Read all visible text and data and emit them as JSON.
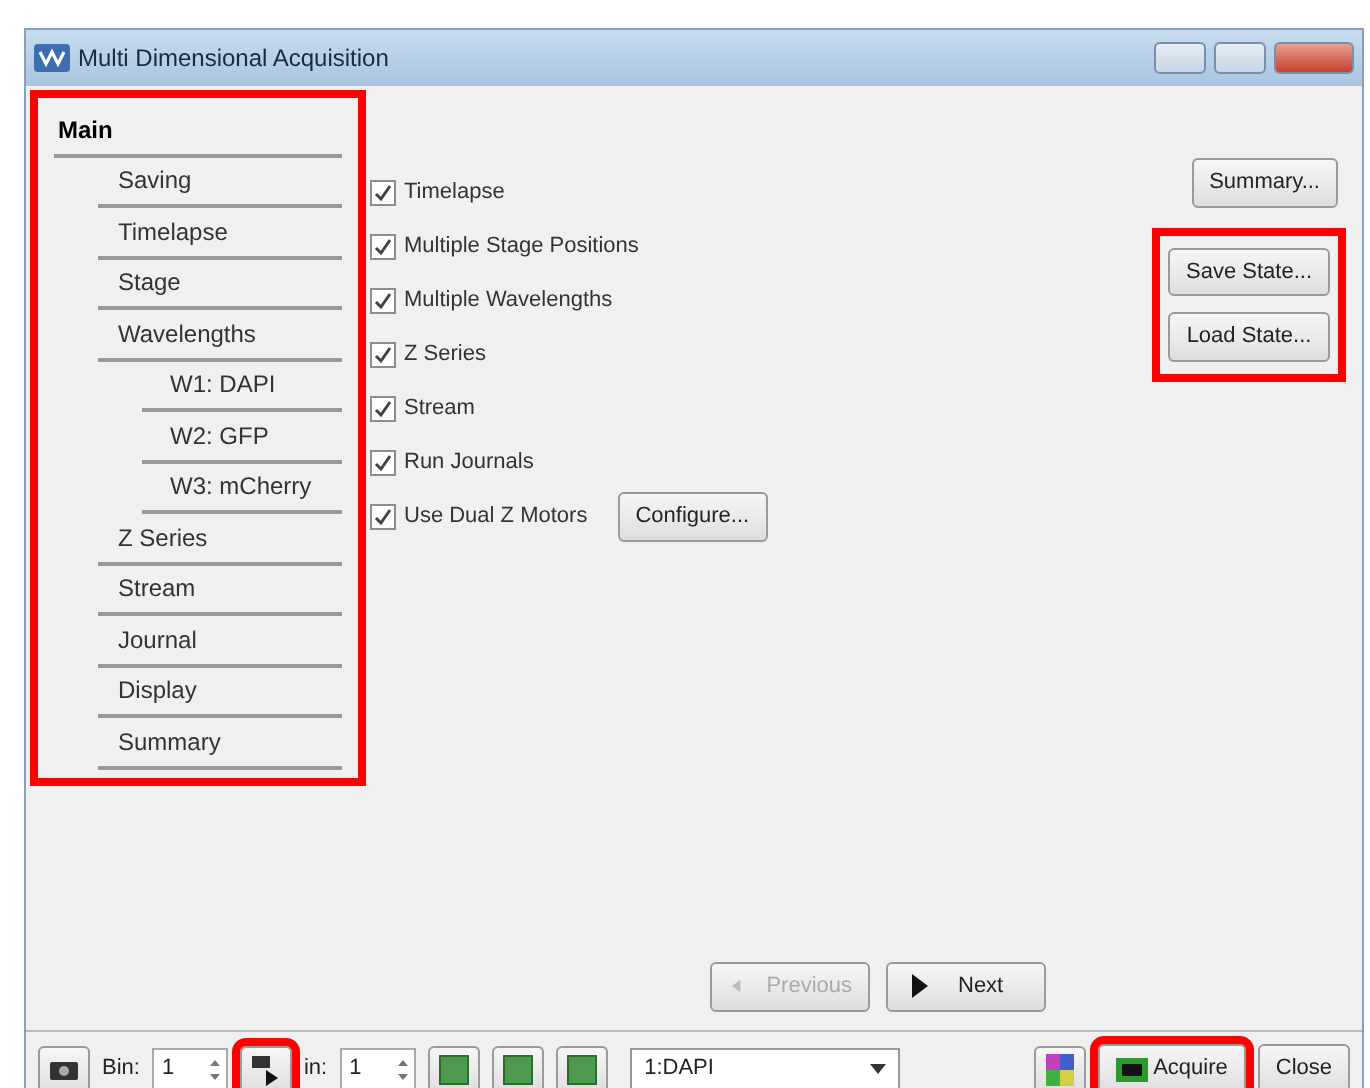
{
  "window": {
    "title": "Multi Dimensional Acquisition"
  },
  "sidebar": {
    "highlighted": true,
    "items": [
      {
        "label": "Main",
        "selected": true
      },
      {
        "label": "Saving",
        "selected": false
      },
      {
        "label": "Timelapse",
        "selected": false
      },
      {
        "label": "Stage",
        "selected": false
      },
      {
        "label": "Wavelengths",
        "selected": false,
        "children": [
          {
            "label": "W1: DAPI",
            "selected": false
          },
          {
            "label": "W2: GFP",
            "selected": false
          },
          {
            "label": "W3: mCherry",
            "selected": false
          }
        ]
      },
      {
        "label": "Z Series",
        "selected": false
      },
      {
        "label": "Stream",
        "selected": false
      },
      {
        "label": "Journal",
        "selected": false
      },
      {
        "label": "Display",
        "selected": false
      },
      {
        "label": "Summary",
        "selected": false
      }
    ]
  },
  "options": [
    {
      "label": "Timelapse",
      "checked": true
    },
    {
      "label": "Multiple Stage Positions",
      "checked": true
    },
    {
      "label": "Multiple Wavelengths",
      "checked": true
    },
    {
      "label": "Z Series",
      "checked": true
    },
    {
      "label": "Stream",
      "checked": true
    },
    {
      "label": "Run Journals",
      "checked": true
    },
    {
      "label": "Use Dual Z Motors",
      "checked": true,
      "button": "Configure..."
    }
  ],
  "side_buttons": {
    "summary": "Summary...",
    "state_group_highlighted": true,
    "state": [
      "Save State...",
      "Load State..."
    ]
  },
  "nav": {
    "previous": {
      "label": "Previous",
      "disabled": true
    },
    "next": {
      "label": "Next",
      "disabled": false
    }
  },
  "toolbar": {
    "bin1_label": "Bin:",
    "bin1_value": "1",
    "play_highlighted": true,
    "bin2_label": "in:",
    "bin2_value": "1",
    "wavelength": "1:DAPI",
    "acquire": {
      "label": "Acquire",
      "highlighted": true
    },
    "close": "Close"
  }
}
